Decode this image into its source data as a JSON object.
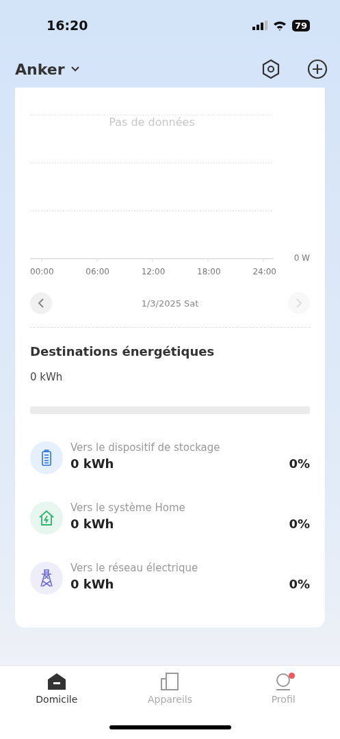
{
  "status_bar": {
    "time": "16:20",
    "battery": "79"
  },
  "header": {
    "title": "Anker"
  },
  "chart": {
    "empty_message": "Pas de données",
    "unit_label": "0 W",
    "x_labels": [
      "00:00",
      "06:00",
      "12:00",
      "18:00",
      "24:00"
    ]
  },
  "date_nav": {
    "date": "1/3/2025 Sat",
    "prev_disabled": false,
    "next_disabled": true
  },
  "destinations": {
    "title": "Destinations énergétiques",
    "total": "0 kWh",
    "items": [
      {
        "kind": "storage",
        "label": "Vers le dispositif de stockage",
        "value": "0 kWh",
        "percent": "0%"
      },
      {
        "kind": "home",
        "label": "Vers le système Home",
        "value": "0 kWh",
        "percent": "0%"
      },
      {
        "kind": "grid",
        "label": "Vers le réseau électrique",
        "value": "0 kWh",
        "percent": "0%"
      }
    ]
  },
  "tabs": [
    {
      "kind": "home",
      "label": "Domicile",
      "selected": true,
      "badge": false
    },
    {
      "kind": "devices",
      "label": "Appareils",
      "selected": false,
      "badge": false
    },
    {
      "kind": "profile",
      "label": "Profil",
      "selected": false,
      "badge": true
    }
  ]
}
